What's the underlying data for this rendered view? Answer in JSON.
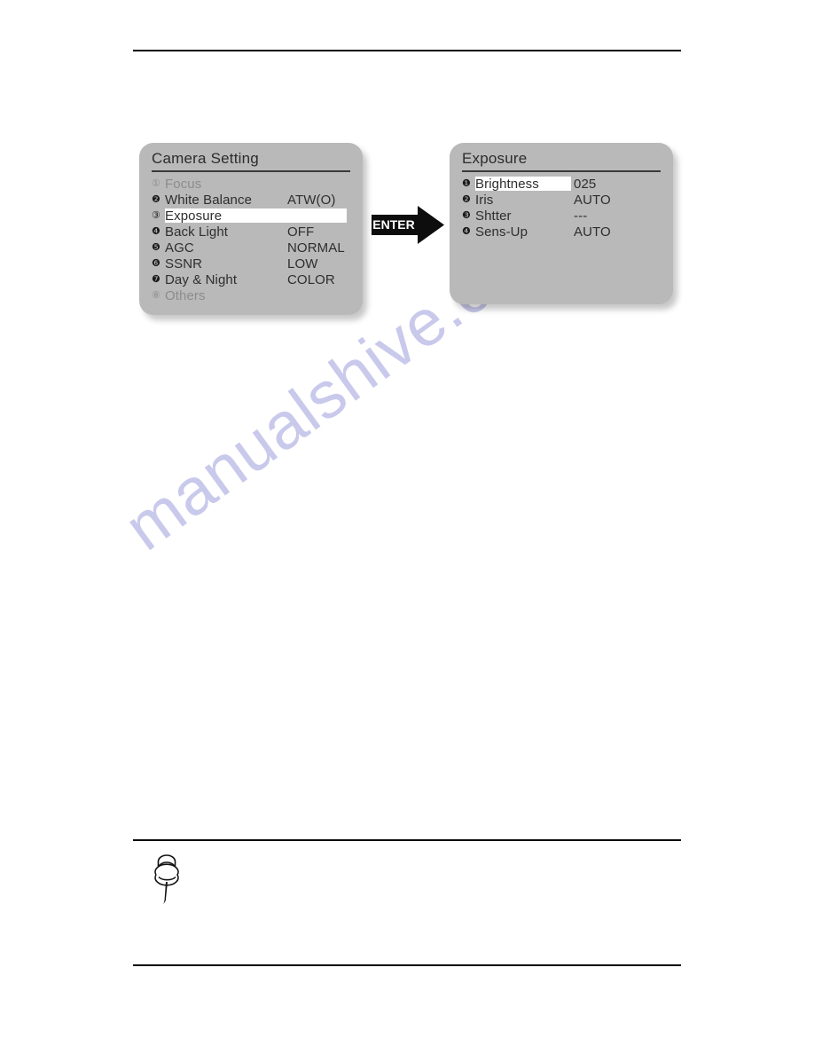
{
  "page": {
    "watermark_text": "manualshive.com",
    "watermark_color": "#c9c9ec",
    "rule_color": "#000000",
    "panel_background": "#b9b9b9",
    "highlight_color": "#ffffff"
  },
  "header_rule": {
    "label": "header-rule"
  },
  "note_rule": {
    "label": "note-rule"
  },
  "footer_rule": {
    "label": "footer-rule"
  },
  "note": {
    "icon": "pushpin-icon"
  },
  "enter_arrow": {
    "label": "ENTER",
    "icon": "right-arrow-icon"
  },
  "camera_setting_panel": {
    "title": "Camera Setting",
    "rows": [
      {
        "bullet": "①",
        "label": "Focus",
        "value": "",
        "selected": false,
        "dimmed": true
      },
      {
        "bullet": "❷",
        "label": "White Balance",
        "value": "ATW(O)",
        "selected": false,
        "dimmed": false
      },
      {
        "bullet": "③",
        "label": "Exposure",
        "value": "",
        "selected": true,
        "dimmed": false
      },
      {
        "bullet": "❹",
        "label": "Back Light",
        "value": "OFF",
        "selected": false,
        "dimmed": false
      },
      {
        "bullet": "❺",
        "label": "AGC",
        "value": "NORMAL",
        "selected": false,
        "dimmed": false
      },
      {
        "bullet": "❻",
        "label": "SSNR",
        "value": "LOW",
        "selected": false,
        "dimmed": false
      },
      {
        "bullet": "❼",
        "label": "Day & Night",
        "value": "COLOR",
        "selected": false,
        "dimmed": false
      },
      {
        "bullet": "⑧",
        "label": "Others",
        "value": "",
        "selected": false,
        "dimmed": true
      }
    ]
  },
  "exposure_panel": {
    "title": "Exposure",
    "rows": [
      {
        "bullet": "❶",
        "label": "Brightness",
        "value": "025",
        "selected": true,
        "dimmed": false
      },
      {
        "bullet": "❷",
        "label": "Iris",
        "value": "AUTO",
        "selected": false,
        "dimmed": false
      },
      {
        "bullet": "❸",
        "label": "Shtter",
        "value": "---",
        "selected": false,
        "dimmed": false
      },
      {
        "bullet": "❹",
        "label": "Sens-Up",
        "value": "AUTO",
        "selected": false,
        "dimmed": false
      }
    ]
  }
}
